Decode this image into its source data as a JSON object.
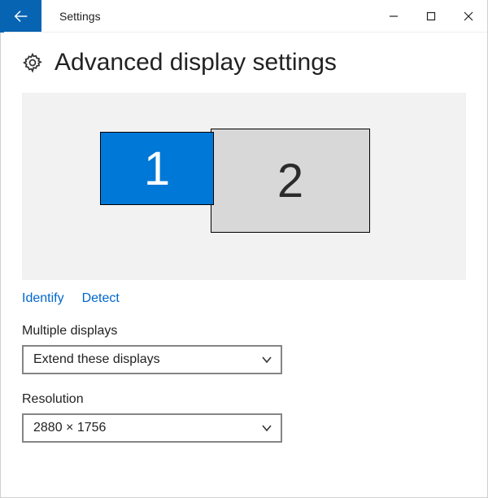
{
  "window": {
    "app_title": "Settings"
  },
  "header": {
    "title": "Advanced display settings"
  },
  "displays": {
    "monitor1_label": "1",
    "monitor2_label": "2"
  },
  "links": {
    "identify": "Identify",
    "detect": "Detect"
  },
  "multiple_displays": {
    "label": "Multiple displays",
    "value": "Extend these displays"
  },
  "resolution": {
    "label": "Resolution",
    "value": "2880 × 1756"
  }
}
